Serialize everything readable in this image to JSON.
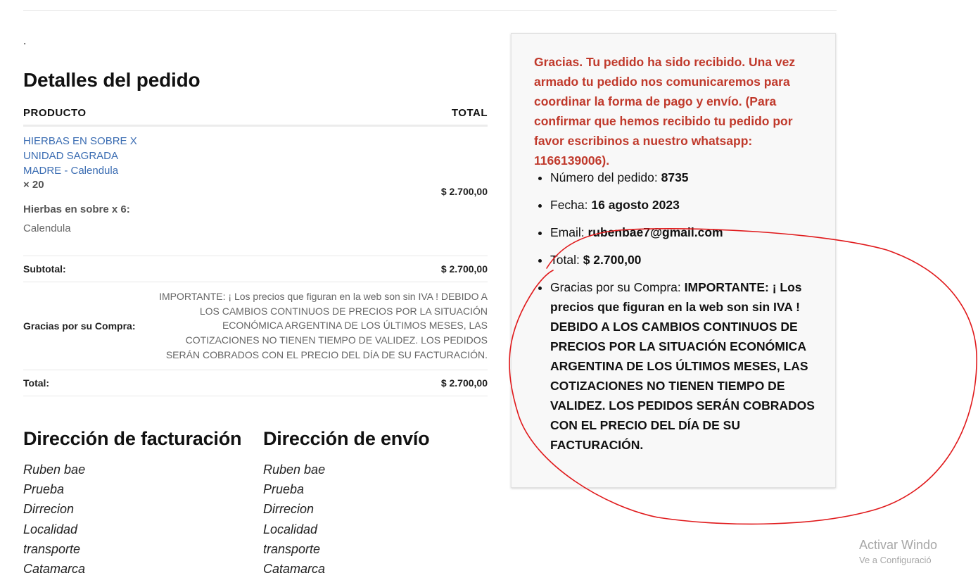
{
  "page": {
    "dot": "."
  },
  "order_details": {
    "title": "Detalles del pedido",
    "columns": {
      "product": "PRODUCTO",
      "total": "TOTAL"
    },
    "item": {
      "name": "HIERBAS EN SOBRE X UNIDAD SAGRADA MADRE - Calendula",
      "quantity": "× 20",
      "meta_label": "Hierbas en sobre x 6:",
      "meta_value": "Calendula",
      "price": "$ 2.700,00"
    },
    "subtotal": {
      "label": "Subtotal:",
      "value": "$ 2.700,00"
    },
    "note": {
      "label": "Gracias por su Compra:",
      "value": "IMPORTANTE: ¡ Los precios que figuran en la web son sin IVA ! DEBIDO A LOS CAMBIOS CONTINUOS DE PRECIOS POR LA SITUACIÓN ECONÓMICA ARGENTINA DE LOS ÚLTIMOS MESES, LAS COTIZACIONES NO TIENEN TIEMPO DE VALIDEZ. LOS PEDIDOS SERÁN COBRADOS CON EL PRECIO DEL DÍA DE SU FACTURACIÓN."
    },
    "total": {
      "label": "Total:",
      "value": "$ 2.700,00"
    }
  },
  "billing": {
    "title": "Dirección de facturación",
    "lines": [
      "Ruben bae",
      "Prueba",
      "Dirrecion",
      "Localidad",
      "transporte",
      "Catamarca"
    ]
  },
  "shipping": {
    "title": "Dirección de envío",
    "lines": [
      "Ruben bae",
      "Prueba",
      "Dirrecion",
      "Localidad",
      "transporte",
      "Catamarca"
    ]
  },
  "thankyou": {
    "message": "Gracias. Tu pedido ha sido recibido. Una vez armado tu pedido nos comunicaremos para coordinar la forma de pago y envío. (Para confirmar que hemos recibido tu pedido por favor escribinos a nuestro whatsapp: 1166139006).",
    "order_number": {
      "label": "Número del pedido: ",
      "value": "8735"
    },
    "date": {
      "label": "Fecha: ",
      "value": "16 agosto 2023"
    },
    "email": {
      "label": "Email: ",
      "value": "rubenbae7@gmail.com"
    },
    "total": {
      "label": "Total: ",
      "value": "$ 2.700,00"
    },
    "note": {
      "label": "Gracias por su Compra: ",
      "value": "IMPORTANTE: ¡ Los precios que figuran en la web son sin IVA ! DEBIDO A LOS CAMBIOS CONTINUOS DE PRECIOS POR LA SITUACIÓN ECONÓMICA ARGENTINA DE LOS ÚLTIMOS MESES, LAS COTIZACIONES NO TIENEN TIEMPO DE VALIDEZ. LOS PEDIDOS SERÁN COBRADOS CON EL PRECIO DEL DÍA DE SU FACTURACIÓN."
    }
  },
  "colors": {
    "link": "#3a6cb2",
    "notice_red": "#c0392b",
    "annotation_red": "#e0191b"
  },
  "watermark": {
    "title": "Activar Windo",
    "subtitle": "Ve a Configuració"
  }
}
